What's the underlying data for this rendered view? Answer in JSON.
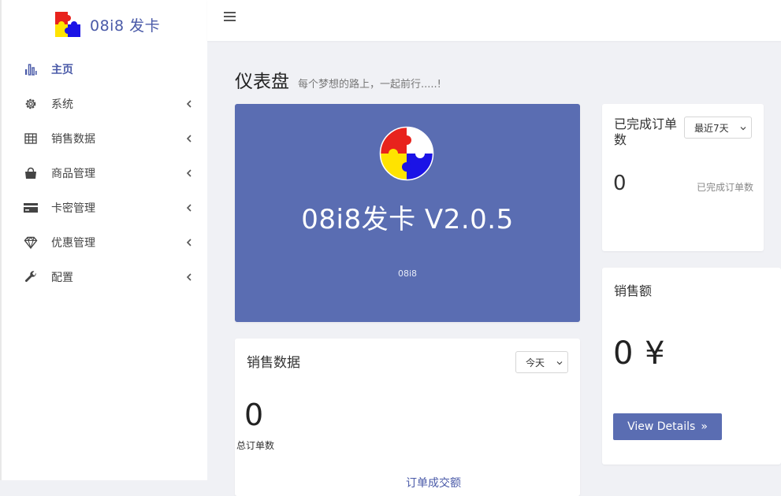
{
  "brand": {
    "name": "08i8 发卡",
    "logo_icon": "puzzle-logo-icon"
  },
  "colors": {
    "primary": "#5a6db2",
    "accent_text": "#4a5aa8",
    "logo_red": "#e8231d",
    "logo_yellow": "#ffe300",
    "logo_blue": "#1b13e6"
  },
  "sidebar": {
    "items": [
      {
        "label": "主页",
        "icon": "bar-chart-icon",
        "active": true,
        "has_submenu": false
      },
      {
        "label": "系统",
        "icon": "gear-icon",
        "active": false,
        "has_submenu": true
      },
      {
        "label": "销售数据",
        "icon": "table-icon",
        "active": false,
        "has_submenu": true
      },
      {
        "label": "商品管理",
        "icon": "shopping-bag-icon",
        "active": false,
        "has_submenu": true
      },
      {
        "label": "卡密管理",
        "icon": "credit-card-icon",
        "active": false,
        "has_submenu": true
      },
      {
        "label": "优惠管理",
        "icon": "diamond-icon",
        "active": false,
        "has_submenu": true
      },
      {
        "label": "配置",
        "icon": "wrench-icon",
        "active": false,
        "has_submenu": true
      }
    ]
  },
  "page": {
    "title": "仪表盘",
    "subtitle": "每个梦想的路上，一起前行.....!"
  },
  "hero": {
    "title": "08i8发卡 V2.0.5",
    "subtitle": "08i8"
  },
  "sales_card": {
    "title": "销售数据",
    "range": "今天",
    "value": "0",
    "label": "总订单数",
    "link_text": "订单成交额"
  },
  "completed_card": {
    "title": "已完成订单数",
    "range": "最近7天",
    "value": "0",
    "label": "已完成订单数"
  },
  "revenue_card": {
    "title": "销售额",
    "value": "0 ¥",
    "button_label": "View Details"
  }
}
